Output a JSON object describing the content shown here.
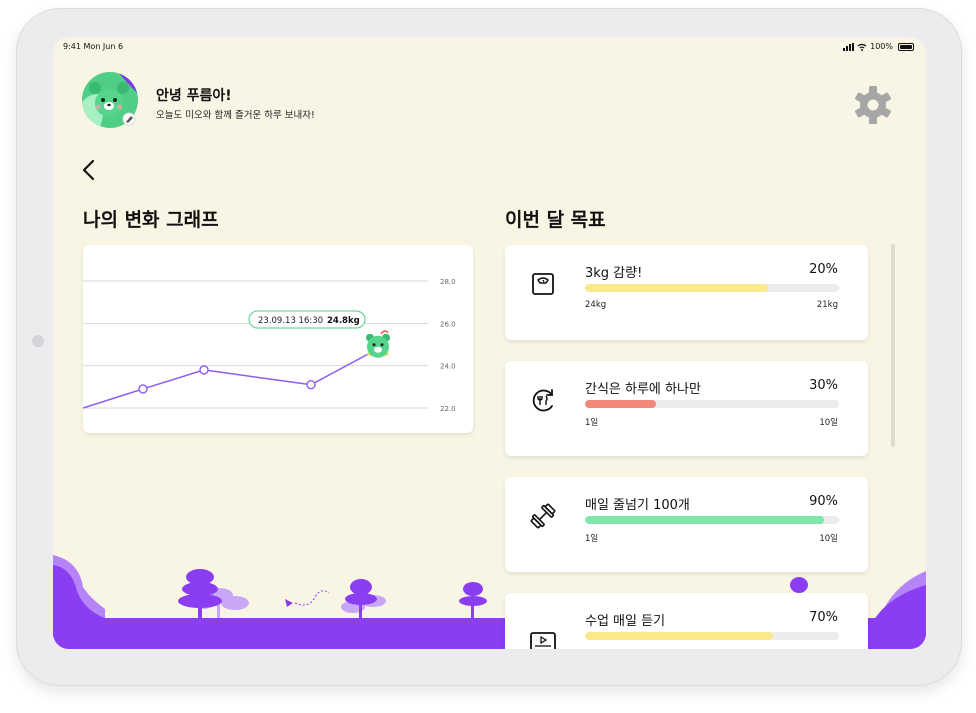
{
  "status": {
    "time": "9:41",
    "date": "Mon Jun 6",
    "battery": "100%"
  },
  "header": {
    "greeting": "안녕 푸름아!",
    "subtitle": "오늘도 미오와 함께 즐거운 하루 보내자!"
  },
  "graph": {
    "title": "나의 변화 그래프",
    "tooltip_date": "23.09.13 16:30",
    "tooltip_value": "24.8kg",
    "y_ticks": [
      "28.0",
      "26.0",
      "24.0",
      "22.0"
    ]
  },
  "chart_data": {
    "type": "line",
    "title": "나의 변화 그래프",
    "ylim": [
      22,
      28
    ],
    "x": [
      0,
      1,
      2,
      3,
      4
    ],
    "y": [
      22.0,
      22.9,
      23.8,
      23.1,
      24.8
    ],
    "ticks": [
      "28.0",
      "26.0",
      "24.0",
      "22.0"
    ],
    "highlight": {
      "label": "23.09.13 16:30",
      "value": "24.8kg"
    },
    "color": "#8b5cf6",
    "grid": true
  },
  "goals": {
    "title": "이번 달 목표",
    "items": [
      {
        "icon": "scale-icon",
        "title": "3kg 감량!",
        "percent": "20%",
        "progress": 0.72,
        "color": "#f9e98a",
        "min": "24kg",
        "max": "21kg"
      },
      {
        "icon": "snack-clock-icon",
        "title": "간식은 하루에 하나만",
        "percent": "30%",
        "progress": 0.28,
        "color": "#f4867a",
        "min": "1일",
        "max": "10일"
      },
      {
        "icon": "dumbbell-icon",
        "title": "매일 줄넘기 100개",
        "percent": "90%",
        "progress": 0.94,
        "color": "#7ee6a8",
        "min": "1일",
        "max": "10일"
      },
      {
        "icon": "video-lesson-icon",
        "title": "수업 매일 듣기",
        "percent": "70%",
        "progress": 0.74,
        "color": "#f9e98a"
      }
    ]
  },
  "colors": {
    "background": "#f8f5e5",
    "accent": "#8b3df2",
    "line": "#8b5cf6"
  }
}
